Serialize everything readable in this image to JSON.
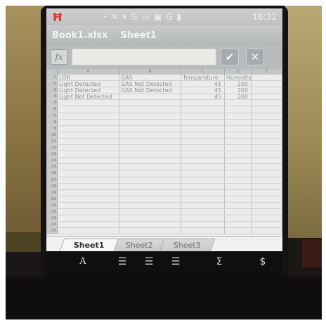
{
  "status_bar": {
    "app_icon": "Ħ",
    "icons": [
      "⁃",
      "✕",
      "▾",
      "G",
      "▭",
      "▣",
      "G",
      "▮"
    ],
    "time": "16:32"
  },
  "title_bar": {
    "file_name": "Book1.xlsx",
    "sheet_name": "Sheet1"
  },
  "formula_bar": {
    "fx_label": "fx",
    "value": "",
    "confirm_symbol": "✔",
    "cancel_symbol": "✕"
  },
  "grid": {
    "columns": [
      "A",
      "B",
      "C",
      "D",
      "E"
    ],
    "rows": [
      {
        "n": "1",
        "A": "LDR",
        "B": "GAS",
        "C": "Temparature",
        "D": "Humidity",
        "E": ""
      },
      {
        "n": "2",
        "A": "Light Detected",
        "B": "GAS Not Detected",
        "C": "45",
        "D": "200",
        "E": ""
      },
      {
        "n": "3",
        "A": "Light Detected",
        "B": "GAS Not Detected",
        "C": "45",
        "D": "200",
        "E": ""
      },
      {
        "n": "4",
        "A": "Light Not Detected",
        "B": "",
        "C": "45",
        "D": "200",
        "E": ""
      },
      {
        "n": "5",
        "A": "",
        "B": "",
        "C": "",
        "D": "",
        "E": ""
      },
      {
        "n": "6",
        "A": "",
        "B": "",
        "C": "",
        "D": "",
        "E": ""
      },
      {
        "n": "7",
        "A": "",
        "B": "",
        "C": "",
        "D": "",
        "E": ""
      },
      {
        "n": "8",
        "A": "",
        "B": "",
        "C": "",
        "D": "",
        "E": ""
      },
      {
        "n": "9",
        "A": "",
        "B": "",
        "C": "",
        "D": "",
        "E": ""
      },
      {
        "n": "10",
        "A": "",
        "B": "",
        "C": "",
        "D": "",
        "E": ""
      },
      {
        "n": "11",
        "A": "",
        "B": "",
        "C": "",
        "D": "",
        "E": ""
      },
      {
        "n": "12",
        "A": "",
        "B": "",
        "C": "",
        "D": "",
        "E": ""
      },
      {
        "n": "13",
        "A": "",
        "B": "",
        "C": "",
        "D": "",
        "E": ""
      },
      {
        "n": "14",
        "A": "",
        "B": "",
        "C": "",
        "D": "",
        "E": ""
      },
      {
        "n": "15",
        "A": "",
        "B": "",
        "C": "",
        "D": "",
        "E": ""
      },
      {
        "n": "16",
        "A": "",
        "B": "",
        "C": "",
        "D": "",
        "E": ""
      },
      {
        "n": "17",
        "A": "",
        "B": "",
        "C": "",
        "D": "",
        "E": ""
      },
      {
        "n": "18",
        "A": "",
        "B": "",
        "C": "",
        "D": "",
        "E": ""
      },
      {
        "n": "19",
        "A": "",
        "B": "",
        "C": "",
        "D": "",
        "E": ""
      },
      {
        "n": "20",
        "A": "",
        "B": "",
        "C": "",
        "D": "",
        "E": ""
      },
      {
        "n": "21",
        "A": "",
        "B": "",
        "C": "",
        "D": "",
        "E": ""
      },
      {
        "n": "22",
        "A": "",
        "B": "",
        "C": "",
        "D": "",
        "E": ""
      },
      {
        "n": "23",
        "A": "",
        "B": "",
        "C": "",
        "D": "",
        "E": ""
      },
      {
        "n": "24",
        "A": "",
        "B": "",
        "C": "",
        "D": "",
        "E": ""
      },
      {
        "n": "25",
        "A": "",
        "B": "",
        "C": "",
        "D": "",
        "E": ""
      }
    ]
  },
  "sheet_tabs": [
    {
      "label": "Sheet1",
      "active": true
    },
    {
      "label": "Sheet2",
      "active": false
    },
    {
      "label": "Sheet3",
      "active": false
    }
  ],
  "toolbar": {
    "font_symbol": "A",
    "align_left_symbol": "☰",
    "align_center_symbol": "☰",
    "align_right_symbol": "☰",
    "sum_symbol": "Σ",
    "currency_symbol": "$"
  },
  "colors": {
    "app_accent": "#e8382f",
    "screen_bg": "#d8d9d8",
    "grid_bg": "#ececea"
  }
}
